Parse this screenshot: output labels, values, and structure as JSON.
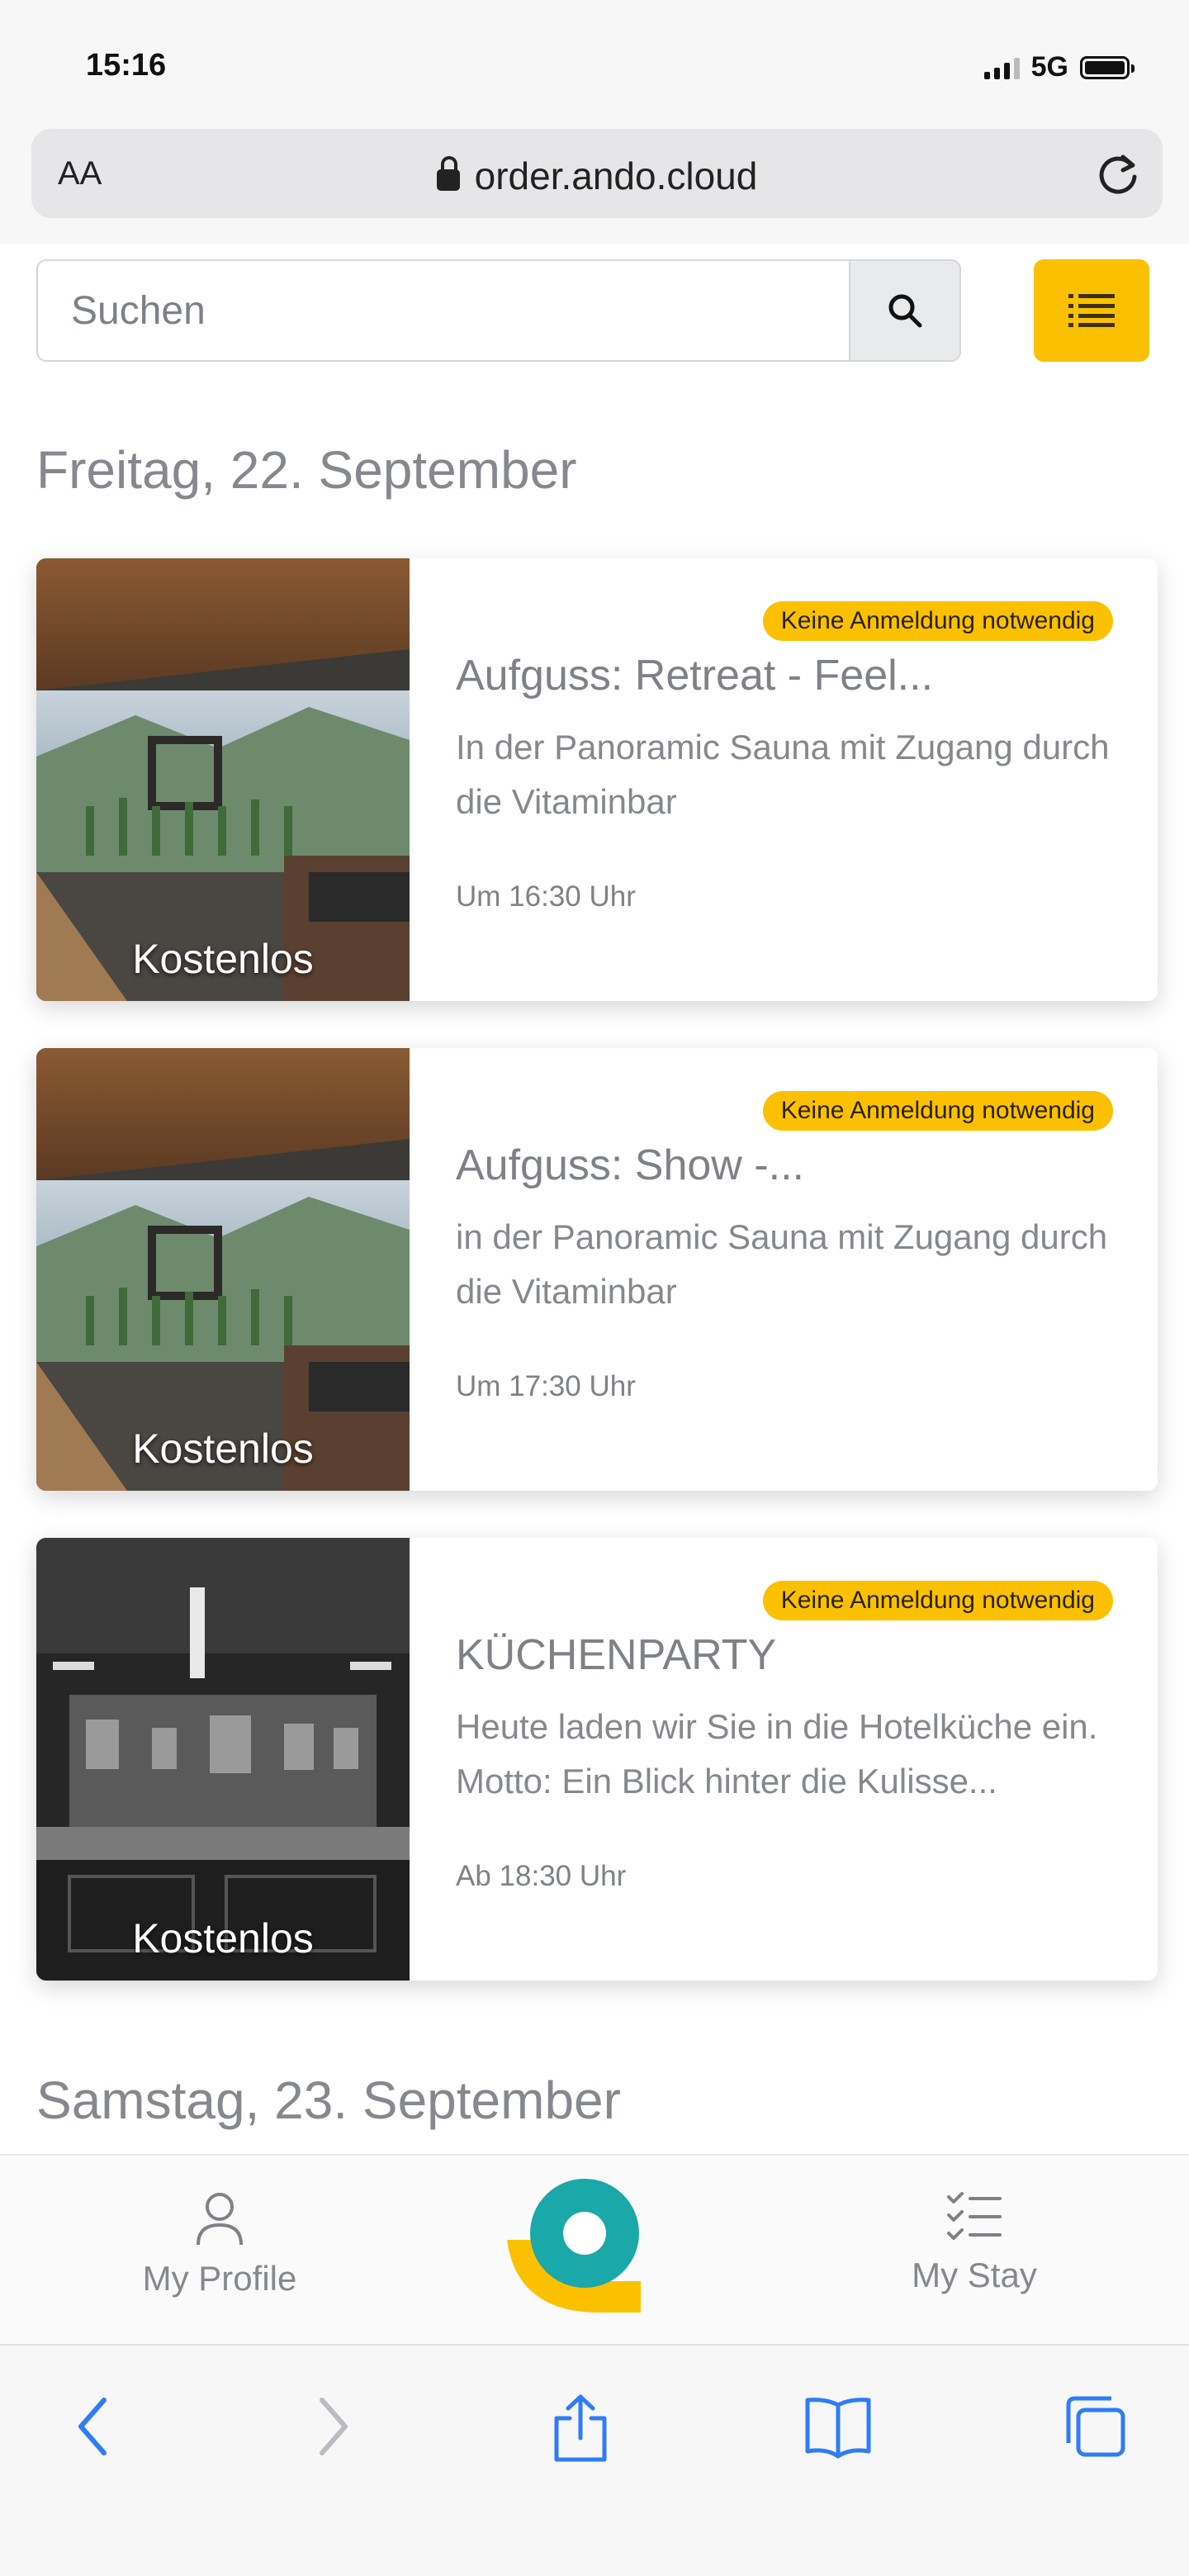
{
  "status_bar": {
    "time": "15:16",
    "network": "5G"
  },
  "browser": {
    "text_size_label": "AA",
    "url": "order.ando.cloud"
  },
  "search": {
    "placeholder": "Suchen"
  },
  "sections": [
    {
      "heading": "Freitag, 22. September",
      "events": [
        {
          "badge": "Keine Anmeldung notwendig",
          "title": "Aufguss: Retreat - Feel...",
          "description": "In der Panoramic Sauna mit Zugang durch die Vitaminbar",
          "time": "Um 16:30 Uhr",
          "price": "Kostenlos",
          "image": "sauna"
        },
        {
          "badge": "Keine Anmeldung notwendig",
          "title": "Aufguss: Show -...",
          "description": "in der Panoramic Sauna mit Zugang durch die Vitaminbar",
          "time": "Um 17:30 Uhr",
          "price": "Kostenlos",
          "image": "sauna"
        },
        {
          "badge": "Keine Anmeldung notwendig",
          "title": "KÜCHENPARTY",
          "description": "Heute laden wir Sie in die Hotelküche ein. Motto: Ein Blick hinter die Kulisse...",
          "time": "Ab 18:30 Uhr",
          "price": "Kostenlos",
          "image": "kitchen"
        }
      ]
    },
    {
      "heading": "Samstag, 23. September",
      "events": []
    }
  ],
  "bottom_nav": {
    "profile_label": "My Profile",
    "stay_label": "My Stay"
  },
  "colors": {
    "accent_yellow": "#fbc101",
    "brand_teal": "#1aa8a8",
    "ios_blue": "#2f7cf6"
  },
  "icons": [
    "search-icon",
    "list-menu-icon",
    "person-icon",
    "checklist-icon",
    "back-icon",
    "forward-icon",
    "share-icon",
    "bookmarks-icon",
    "tabs-icon"
  ]
}
